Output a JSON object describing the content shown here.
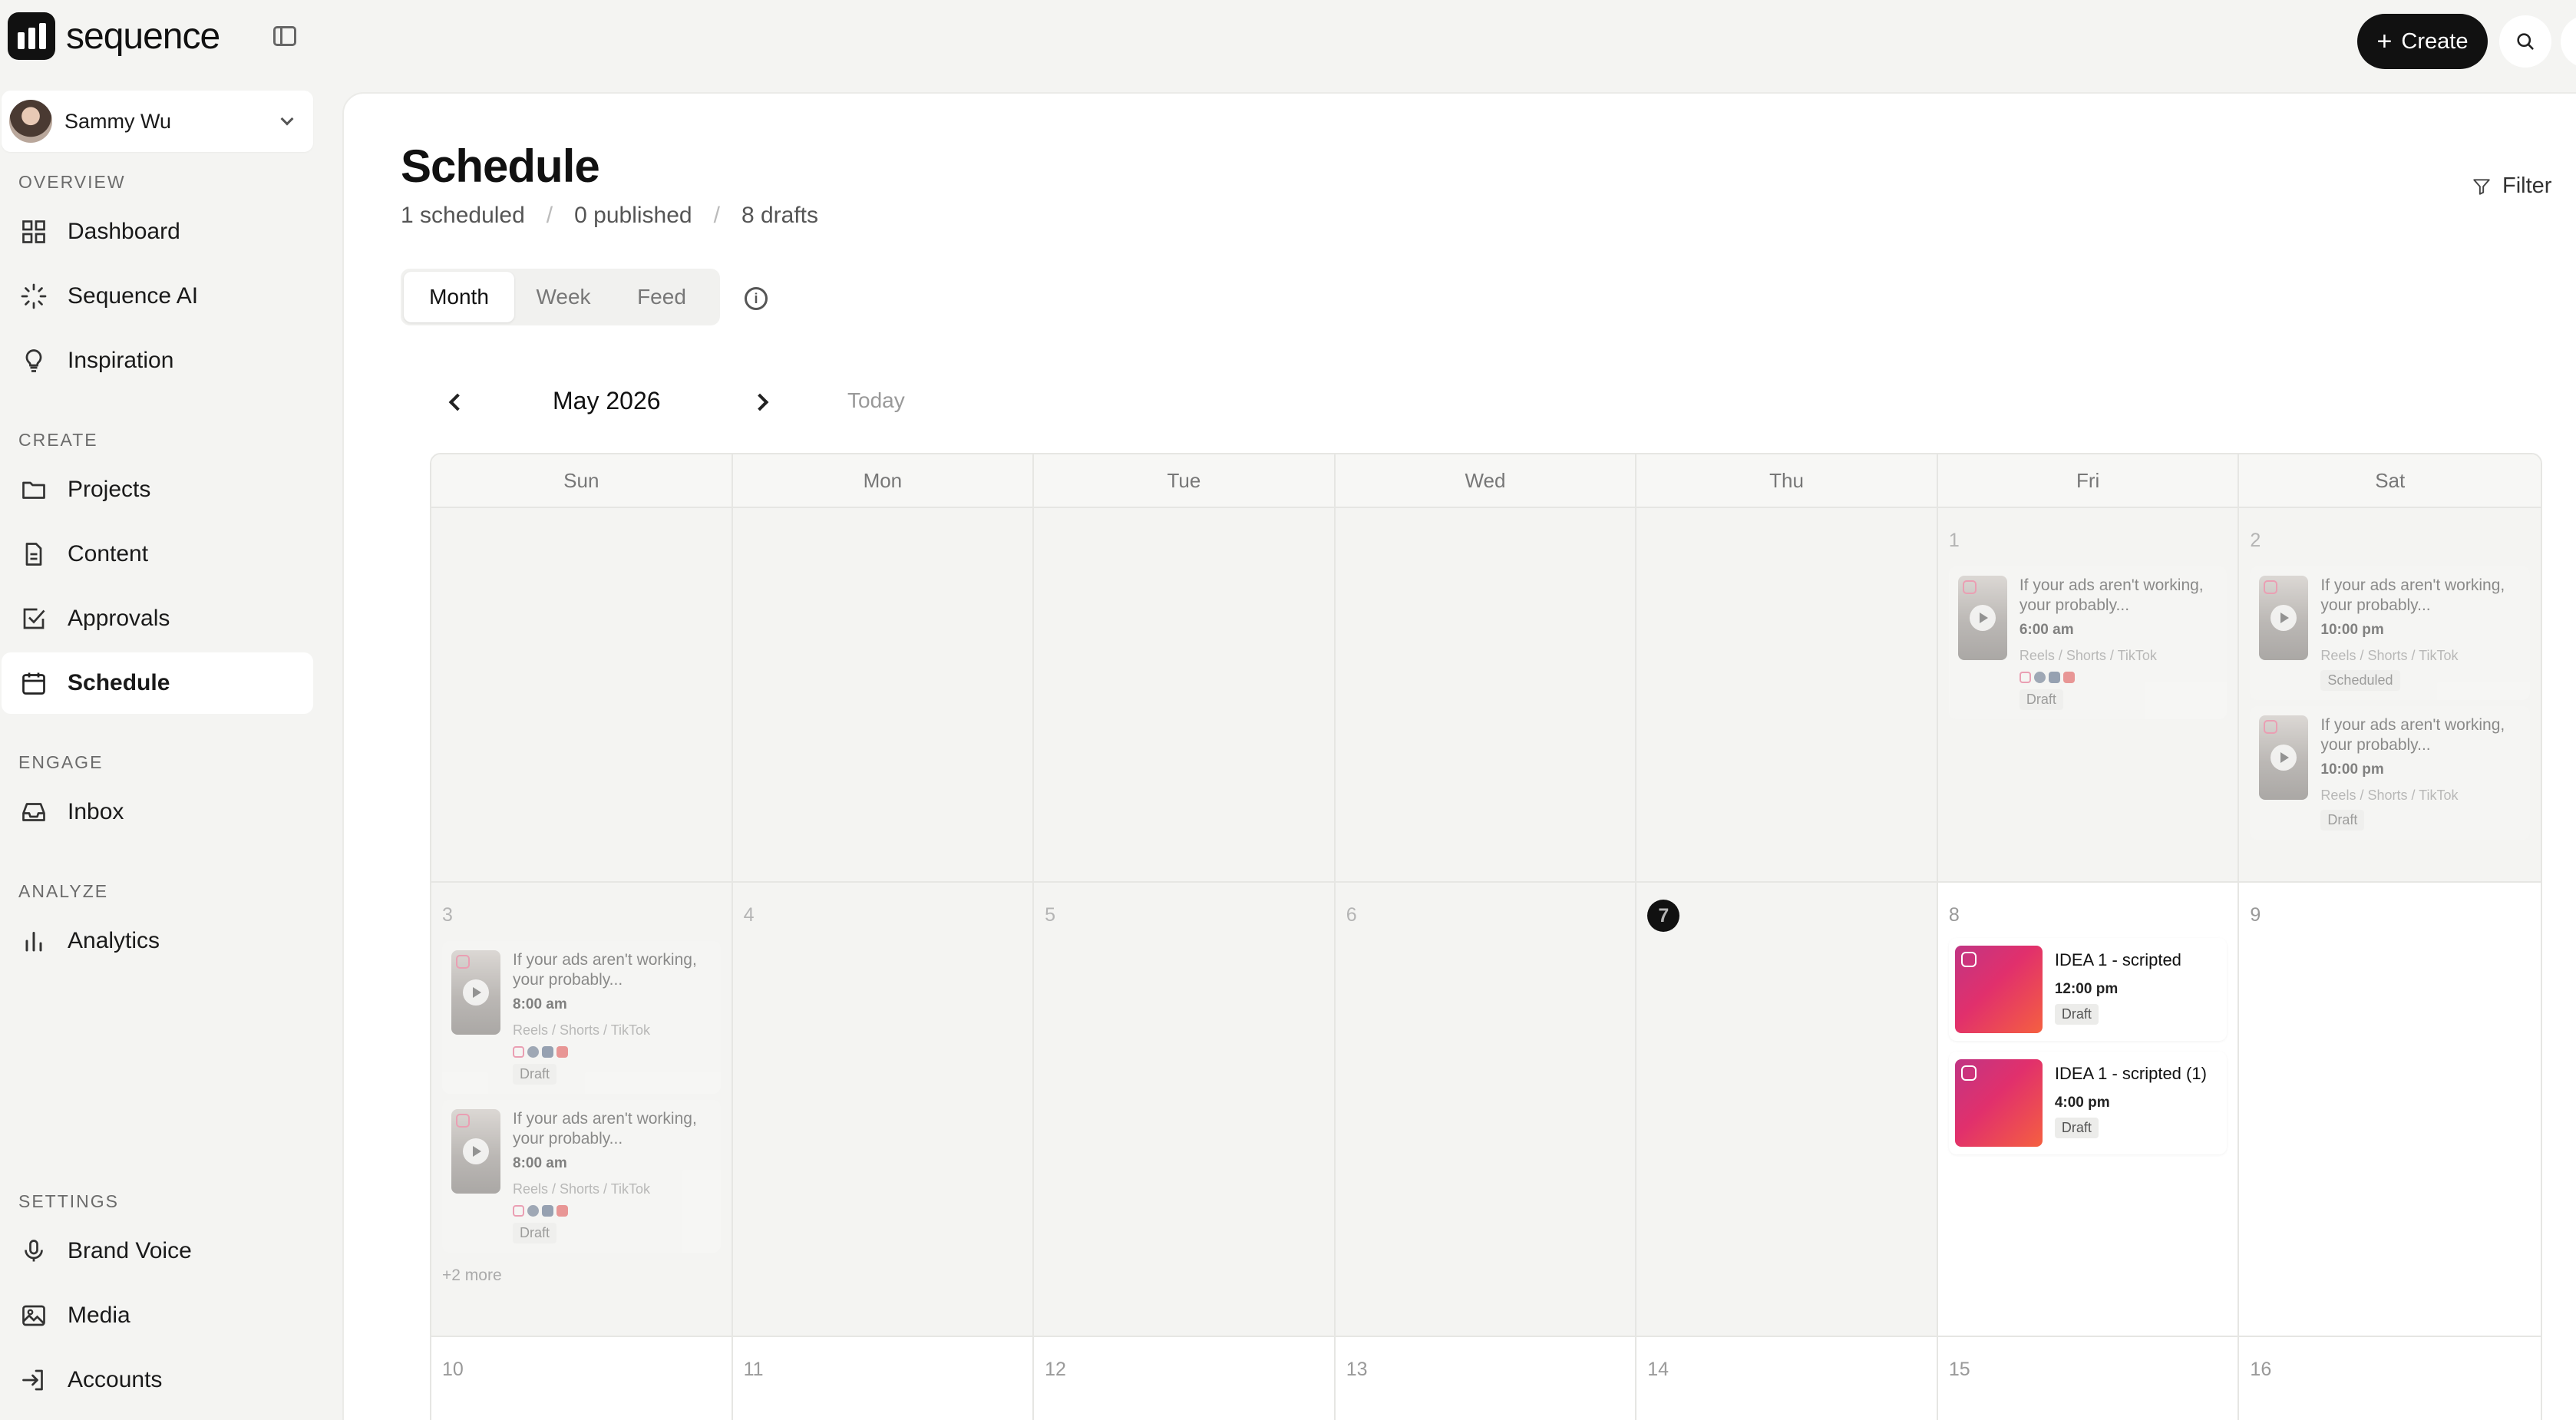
{
  "app": {
    "brand": "sequence"
  },
  "topbar": {
    "create_label": "Create"
  },
  "user": {
    "name": "Sammy Wu"
  },
  "sidebar": {
    "sections": {
      "overview": "OVERVIEW",
      "create": "CREATE",
      "engage": "ENGAGE",
      "analyze": "ANALYZE",
      "settings": "SETTINGS"
    },
    "items": {
      "dashboard": "Dashboard",
      "sequence_ai": "Sequence AI",
      "inspiration": "Inspiration",
      "projects": "Projects",
      "content": "Content",
      "approvals": "Approvals",
      "schedule": "Schedule",
      "inbox": "Inbox",
      "analytics": "Analytics",
      "brand_voice": "Brand Voice",
      "media": "Media",
      "accounts": "Accounts"
    },
    "active": "Schedule"
  },
  "page": {
    "title": "Schedule",
    "stats": {
      "scheduled": "1 scheduled",
      "published": "0 published",
      "drafts": "8 drafts"
    },
    "filter_label": "Filter",
    "views": {
      "month": "Month",
      "week": "Week",
      "feed": "Feed"
    },
    "active_view": "Month"
  },
  "calendar": {
    "month_label": "May 2026",
    "today_label": "Today",
    "weekdays": [
      "Sun",
      "Mon",
      "Tue",
      "Wed",
      "Thu",
      "Fri",
      "Sat"
    ],
    "week1": {
      "fri_num": "1",
      "sat_num": "2",
      "fri_post": {
        "title": "If your ads aren't working, your probably...",
        "time": "6:00 am",
        "types": "Reels / Shorts / TikTok",
        "status": "Draft"
      },
      "sat_post1": {
        "title": "If your ads aren't working, your probably...",
        "time": "10:00 pm",
        "types": "Reels / Shorts / TikTok",
        "status": "Scheduled"
      },
      "sat_post2": {
        "title": "If your ads aren't working, your probably...",
        "time": "10:00 pm",
        "types": "Reels / Shorts / TikTok",
        "status": "Draft"
      }
    },
    "week2": {
      "nums": [
        "3",
        "4",
        "5",
        "6",
        "7",
        "8",
        "9"
      ],
      "sun_post1": {
        "title": "If your ads aren't working, your probably...",
        "time": "8:00 am",
        "types": "Reels / Shorts / TikTok",
        "status": "Draft"
      },
      "sun_post2": {
        "title": "If your ads aren't working, your probably...",
        "time": "8:00 am",
        "types": "Reels / Shorts / TikTok",
        "status": "Draft"
      },
      "more": "+2 more",
      "fri_idea1": {
        "title": "IDEA 1 - scripted",
        "time": "12:00 pm",
        "status": "Draft"
      },
      "fri_idea2": {
        "title": "IDEA 1 - scripted (1)",
        "time": "4:00 pm",
        "status": "Draft"
      }
    },
    "week3": {
      "nums": [
        "10",
        "11",
        "12",
        "13",
        "14",
        "15",
        "16"
      ]
    }
  }
}
